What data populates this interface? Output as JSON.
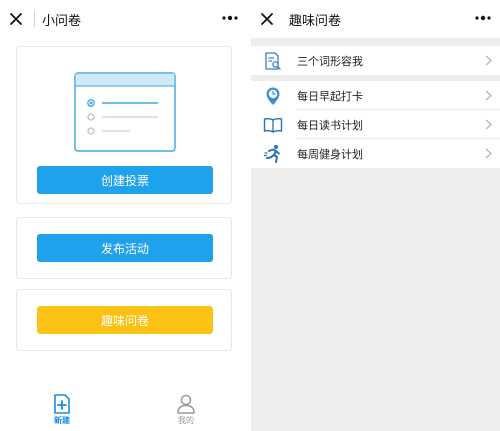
{
  "left": {
    "nav_title": "小问卷",
    "buttons": {
      "create_vote": "创建投票",
      "publish_activity": "发布活动",
      "fun_survey": "趣味问卷"
    },
    "tabs": [
      {
        "label": "新建",
        "icon": "new-document-icon",
        "active": true
      },
      {
        "label": "我的",
        "icon": "person-icon",
        "active": false
      }
    ]
  },
  "right": {
    "nav_title": "趣味问卷",
    "groups": [
      [
        {
          "label": "三个词形容我",
          "icon": "search-document-icon"
        }
      ],
      [
        {
          "label": "每日早起打卡",
          "icon": "clock-pin-icon"
        },
        {
          "label": "每日读书计划",
          "icon": "book-icon"
        },
        {
          "label": "每周健身计划",
          "icon": "runner-icon"
        }
      ]
    ]
  },
  "colors": {
    "accent_blue": "#1fa2ec",
    "accent_yellow": "#fcc114",
    "background_gray": "#ededed"
  }
}
